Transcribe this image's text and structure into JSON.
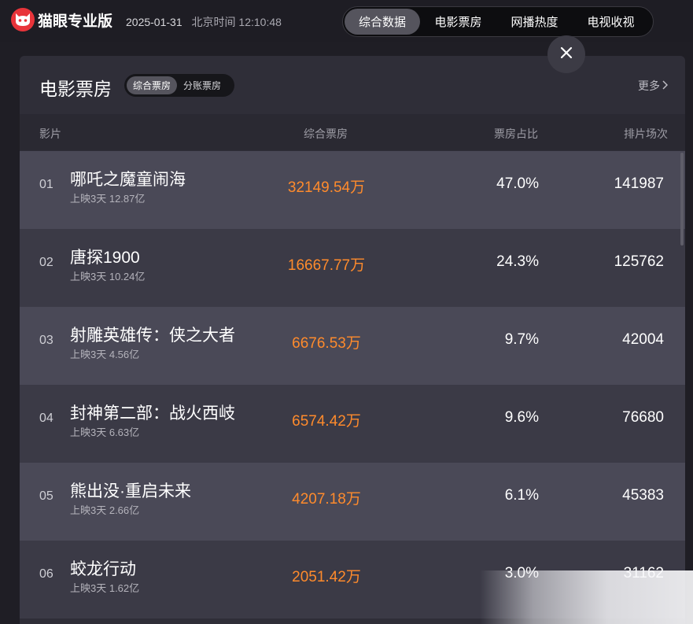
{
  "header": {
    "brand": "猫眼专业版",
    "date": "2025-01-31",
    "time_label": "北京时间",
    "time": "12:10:48",
    "tabs": [
      {
        "label": "综合数据",
        "active": true
      },
      {
        "label": "电影票房",
        "active": false
      },
      {
        "label": "网播热度",
        "active": false
      },
      {
        "label": "电视收视",
        "active": false
      }
    ]
  },
  "panel": {
    "title": "电影票房",
    "sub_tabs": [
      {
        "label": "综合票房",
        "active": true
      },
      {
        "label": "分账票房",
        "active": false
      }
    ],
    "more_label": "更多"
  },
  "table": {
    "columns": {
      "film": "影片",
      "box_office": "综合票房",
      "share": "票房占比",
      "shows": "排片场次"
    },
    "rows": [
      {
        "rank": "01",
        "name": "哪吒之魔童闹海",
        "meta": "上映3天  12.87亿",
        "box": "32149.54万",
        "share": "47.0%",
        "shows": "141987"
      },
      {
        "rank": "02",
        "name": "唐探1900",
        "meta": "上映3天  10.24亿",
        "box": "16667.77万",
        "share": "24.3%",
        "shows": "125762"
      },
      {
        "rank": "03",
        "name": "射雕英雄传：侠之大者",
        "meta": "上映3天  4.56亿",
        "box": "6676.53万",
        "share": "9.7%",
        "shows": "42004"
      },
      {
        "rank": "04",
        "name": "封神第二部：战火西岐",
        "meta": "上映3天  6.63亿",
        "box": "6574.42万",
        "share": "9.6%",
        "shows": "76680"
      },
      {
        "rank": "05",
        "name": "熊出没·重启未来",
        "meta": "上映3天  2.66亿",
        "box": "4207.18万",
        "share": "6.1%",
        "shows": "45383"
      },
      {
        "rank": "06",
        "name": "蛟龙行动",
        "meta": "上映3天  1.62亿",
        "box": "2051.42万",
        "share": "3.0%",
        "shows": "31162"
      }
    ]
  },
  "colors": {
    "accent_orange": "#ff8b2c",
    "brand_red": "#e8343a"
  },
  "icons": {
    "logo": "cat-logo-icon",
    "close": "close-icon",
    "more": "chevron-right-icon"
  }
}
